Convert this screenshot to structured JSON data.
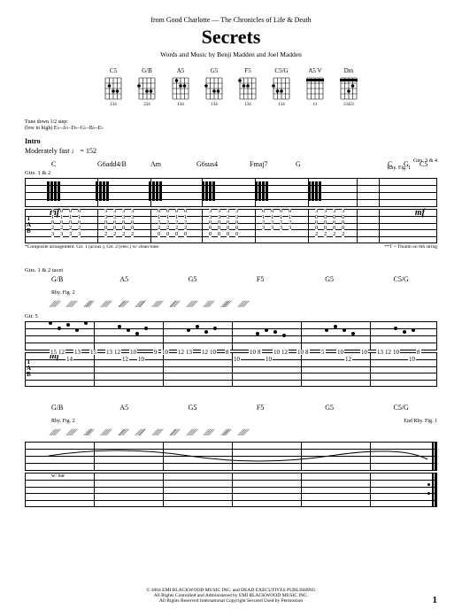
{
  "header": {
    "source": "from Good Charlotte — The Chronicles of Life & Death",
    "title": "Secrets",
    "credit": "Words and Music by Benji Madden and Joel Madden"
  },
  "chord_diagrams": [
    {
      "name": "C5",
      "fingering": "134"
    },
    {
      "name": "G/B",
      "fingering": "234"
    },
    {
      "name": "A5",
      "fingering": "134"
    },
    {
      "name": "G5",
      "fingering": "134"
    },
    {
      "name": "F5",
      "fingering": "134"
    },
    {
      "name": "C5/G",
      "fingering": "134"
    },
    {
      "name": "A5 V",
      "fingering": "11"
    },
    {
      "name": "Dm",
      "fingering": "13421"
    }
  ],
  "tuning_note": {
    "l1": "Tune down 1/2 step:",
    "l2": "(low to high) E♭–A♭–D♭–G♭–B♭–E♭"
  },
  "intro": {
    "label": "Intro",
    "tempo": "Moderately fast ♩ = 152"
  },
  "system1": {
    "chords": [
      "C",
      "G6add4/B",
      "Am",
      "G6sus4",
      "Fmaj7",
      "G"
    ],
    "right_chords": [
      "C",
      "G",
      "C5"
    ],
    "gtr_label": "Gtrs. 1 & 2",
    "tab_col": [
      "0",
      "1",
      "0",
      "2",
      "3",
      ""
    ],
    "tab_col_b": [
      "3",
      "3",
      "0",
      "0",
      "2",
      ""
    ],
    "tab_col_am": [
      "0",
      "1",
      "2",
      "2",
      "0",
      ""
    ],
    "tab_col_g6": [
      "3",
      "3",
      "0",
      "0",
      "0",
      ""
    ],
    "tab_col_f": [
      "0",
      "1",
      "2",
      "3",
      "",
      ""
    ],
    "tab_col_g": [
      "3",
      "0",
      "0",
      "0",
      "2",
      ""
    ],
    "rhyfig_label": "Gtrs. 3 & 4",
    "rhyfig_text": "Rhy. Fig. 1",
    "dyn": "mf",
    "dyn2": "mf",
    "footnote_l": "*Composite arrangement. Gtr. 1 (acous.), Gtr. 2 (elec.) w/ clean tone.",
    "footnote_r": "**T = Thumb on 6th string"
  },
  "system2": {
    "gtr_label": "Gtrs. 1 & 2 tacet",
    "chords": [
      "G/B",
      "A5",
      "G5",
      "F5",
      "G5",
      "C5/G"
    ],
    "rhyfig_text": "Rhy. Fig. 2",
    "gtr5_label": "Gtr. 5",
    "dyn": "mf",
    "tab_rows": [
      [
        "15",
        "12",
        "",
        "13",
        "",
        "15",
        "",
        "13",
        "12",
        "",
        "10",
        "",
        "",
        "9",
        "10",
        "",
        "12",
        "13",
        "",
        "12",
        "10",
        "",
        "8",
        "",
        "",
        "10",
        "8",
        "",
        "10",
        "12",
        "",
        "10",
        "8",
        "",
        "5",
        "",
        "10",
        "",
        "",
        "10",
        "",
        "13",
        "12",
        "10",
        "",
        "",
        "8"
      ],
      [
        "",
        "",
        "14",
        "",
        "",
        "",
        "",
        "",
        "",
        "12",
        "",
        "10",
        "",
        "",
        "",
        "",
        "",
        "",
        "",
        "",
        "",
        "",
        "",
        "10",
        "",
        "",
        "",
        "10",
        "",
        "",
        "",
        "",
        "",
        "",
        "",
        "",
        "",
        "12",
        "",
        "",
        "",
        "",
        "",
        "",
        "",
        "10",
        ""
      ]
    ]
  },
  "system3": {
    "chords": [
      "G/B",
      "A5",
      "G5",
      "F5",
      "G5",
      "C5/G"
    ],
    "end_label": "End Rhy. Fig. 1",
    "rhyfig_text": "Rhy. Fig. 2",
    "wbar": "w/ bar"
  },
  "copyright": {
    "l1": "© 2004 EMI BLACKWOOD MUSIC INC. and DEAD EXECUTIVES PUBLISHING",
    "l2": "All Rights Controlled and Administered by EMI BLACKWOOD MUSIC INC.",
    "l3": "All Rights Reserved   International Copyright Secured   Used by Permission"
  },
  "page_number": "1"
}
